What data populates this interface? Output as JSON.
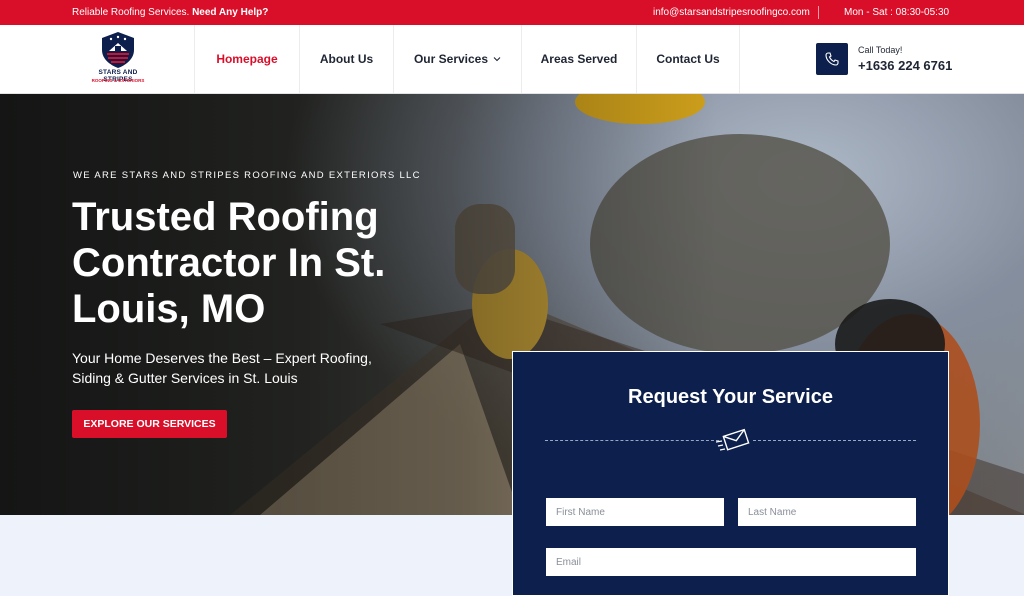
{
  "topbar": {
    "tagline": "Reliable Roofing Services.",
    "help": "Need Any Help?",
    "email": "info@starsandstripesroofingco.com",
    "hours": "Mon - Sat : 08:30-05:30"
  },
  "logo": {
    "line1": "STARS AND STRIPES",
    "line2": "ROOFING & EXTERIORS"
  },
  "nav": {
    "items": [
      {
        "label": "Homepage",
        "active": true
      },
      {
        "label": "About Us"
      },
      {
        "label": "Our Services",
        "has_dropdown": true
      },
      {
        "label": "Areas Served"
      },
      {
        "label": "Contact Us"
      }
    ]
  },
  "call": {
    "label": "Call Today!",
    "number": "+1636 224 6761",
    "icon": "phone-icon"
  },
  "hero": {
    "kicker": "WE ARE STARS AND STRIPES ROOFING AND EXTERIORS LLC",
    "title": "Trusted Roofing Contractor In St. Louis, MO",
    "subtitle": "Your Home Deserves the Best – Expert Roofing, Siding & Gutter Services in St. Louis",
    "cta": "EXPLORE OUR SERVICES"
  },
  "form": {
    "title": "Request Your Service",
    "icon": "envelope-icon",
    "first_name_placeholder": "First Name",
    "last_name_placeholder": "Last Name",
    "email_placeholder": "Email"
  },
  "colors": {
    "brand_red": "#d90f2a",
    "navy": "#0d1f4c"
  }
}
